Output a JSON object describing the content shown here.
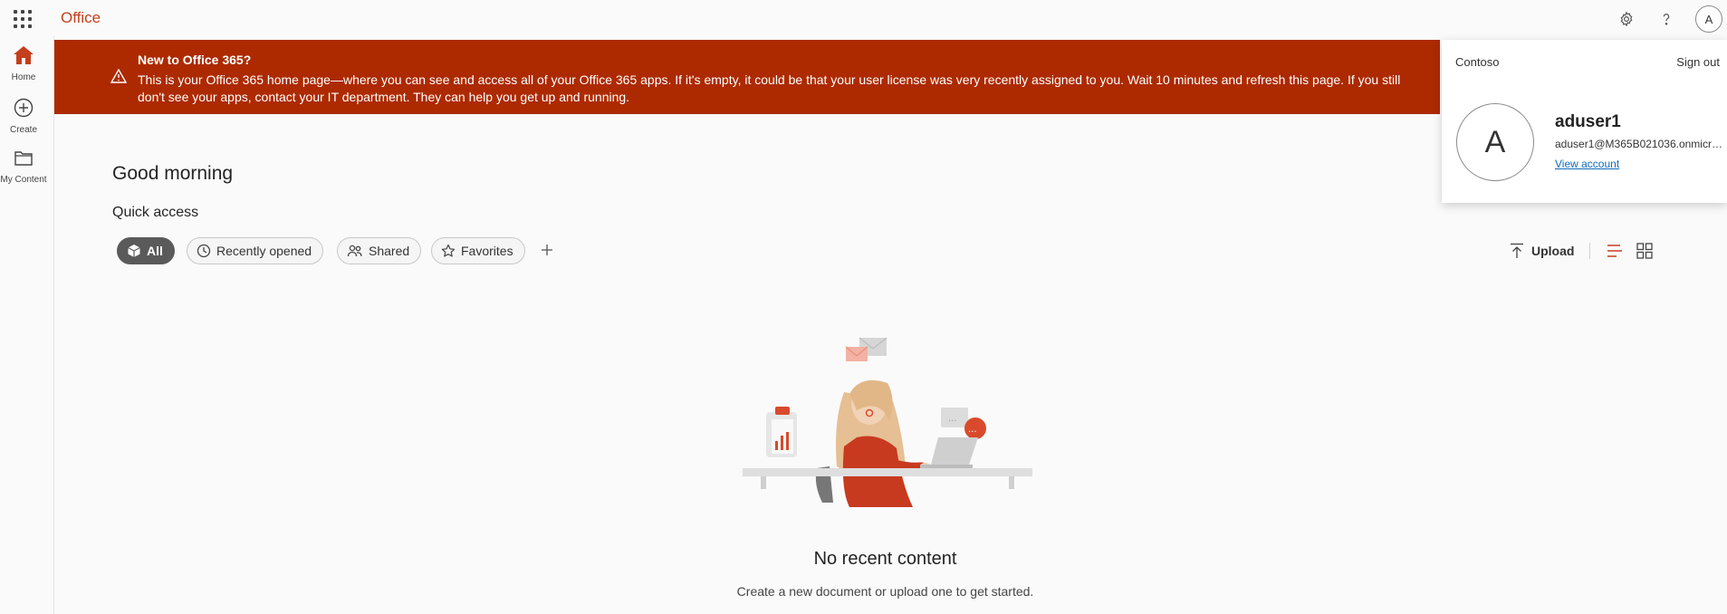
{
  "app": {
    "brand": "Office"
  },
  "rail": {
    "home": "Home",
    "create": "Create",
    "my_content": "My Content"
  },
  "banner": {
    "title": "New to Office 365?",
    "text": "This is your Office 365 home page—where you can see and access all of your Office 365 apps. If it's empty, it could be that your user license was very recently assigned to you. Wait 10 minutes and refresh this page. If you still don't see your apps, contact your IT department. They can help you get up and running."
  },
  "main": {
    "greeting": "Good morning",
    "quick_access": "Quick access",
    "filters": [
      "All",
      "Recently opened",
      "Shared",
      "Favorites"
    ],
    "upload": "Upload",
    "empty_title": "No recent content",
    "empty_sub": "Create a new document or upload one to get started."
  },
  "account": {
    "tenant": "Contoso",
    "sign_out": "Sign out",
    "initial": "A",
    "name": "aduser1",
    "email": "aduser1@M365B021036.onmicrosoft.com",
    "view_account": "View account"
  },
  "colors": {
    "accent": "#c43e1c",
    "banner": "#ad2a00",
    "link": "#0f6cbd"
  }
}
